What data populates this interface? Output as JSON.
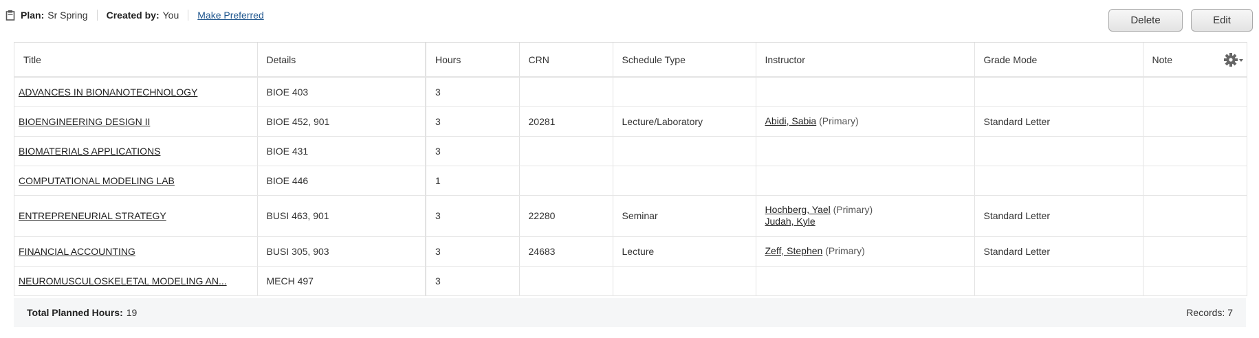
{
  "plan": {
    "plan_label": "Plan:",
    "plan_value": "Sr Spring",
    "created_label": "Created by:",
    "created_value": "You",
    "make_preferred": "Make Preferred"
  },
  "actions": {
    "delete": "Delete",
    "edit": "Edit"
  },
  "columns": [
    "Title",
    "Details",
    "Hours",
    "CRN",
    "Schedule Type",
    "Instructor",
    "Grade Mode",
    "Note"
  ],
  "rows": [
    {
      "title": "ADVANCES IN BIONANOTECHNOLOGY",
      "details": "BIOE 403",
      "hours": "3",
      "crn": "",
      "schedule_type": "",
      "instructors": [],
      "grade_mode": "",
      "note": ""
    },
    {
      "title": "BIOENGINEERING DESIGN II",
      "details": "BIOE 452, 901",
      "hours": "3",
      "crn": "20281",
      "schedule_type": "Lecture/Laboratory",
      "instructors": [
        {
          "name": "Abidi, Sabia",
          "role": "(Primary)"
        }
      ],
      "grade_mode": "Standard Letter",
      "note": ""
    },
    {
      "title": "BIOMATERIALS APPLICATIONS",
      "details": "BIOE 431",
      "hours": "3",
      "crn": "",
      "schedule_type": "",
      "instructors": [],
      "grade_mode": "",
      "note": ""
    },
    {
      "title": "COMPUTATIONAL MODELING LAB",
      "details": "BIOE 446",
      "hours": "1",
      "crn": "",
      "schedule_type": "",
      "instructors": [],
      "grade_mode": "",
      "note": ""
    },
    {
      "title": "ENTREPRENEURIAL STRATEGY",
      "details": "BUSI 463, 901",
      "hours": "3",
      "crn": "22280",
      "schedule_type": "Seminar",
      "instructors": [
        {
          "name": "Hochberg, Yael",
          "role": "(Primary)"
        },
        {
          "name": "Judah, Kyle",
          "role": ""
        }
      ],
      "grade_mode": "Standard Letter",
      "note": ""
    },
    {
      "title": "FINANCIAL ACCOUNTING",
      "details": "BUSI 305, 903",
      "hours": "3",
      "crn": "24683",
      "schedule_type": "Lecture",
      "instructors": [
        {
          "name": "Zeff, Stephen",
          "role": "(Primary)"
        }
      ],
      "grade_mode": "Standard Letter",
      "note": ""
    },
    {
      "title": "NEUROMUSCULOSKELETAL MODELING AN...",
      "details": "MECH 497",
      "hours": "3",
      "crn": "",
      "schedule_type": "",
      "instructors": [],
      "grade_mode": "",
      "note": ""
    }
  ],
  "footer": {
    "total_label": "Total Planned Hours:",
    "total_value": "19",
    "records": "Records: 7"
  },
  "icons": {
    "plan": "clipboard-icon",
    "settings": "gear-icon"
  }
}
